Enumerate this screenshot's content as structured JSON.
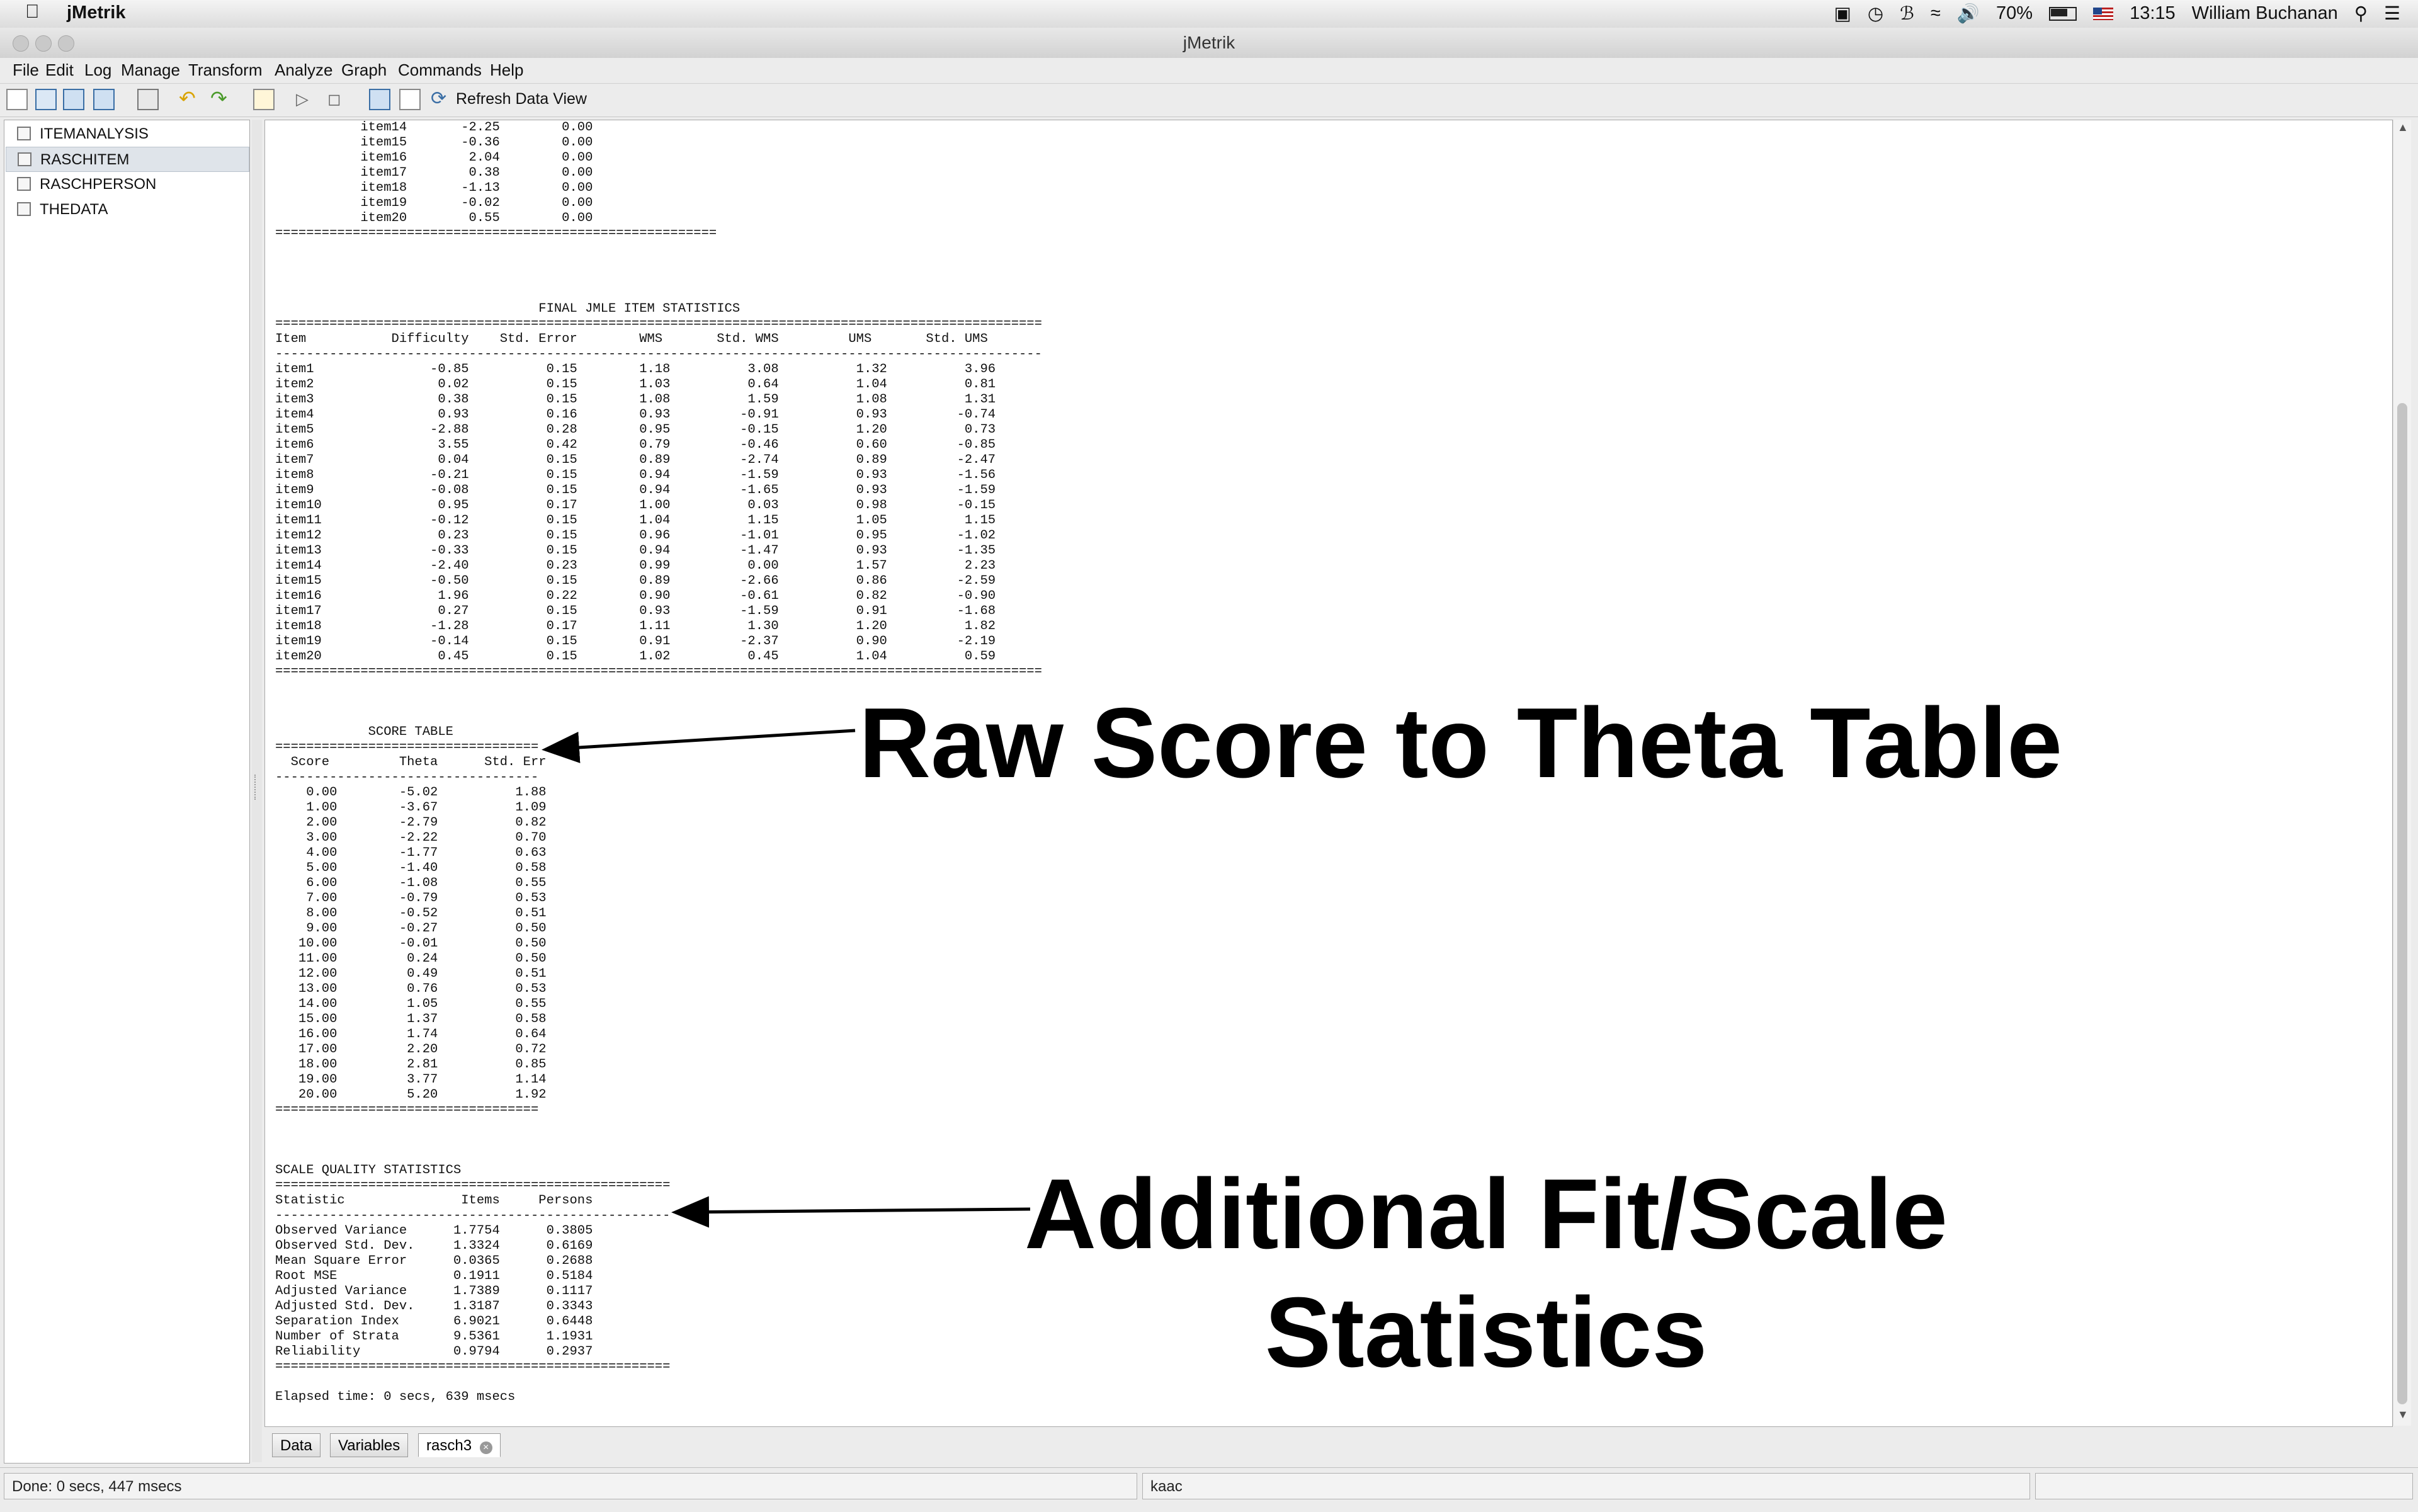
{
  "os_menubar": {
    "app_name": "jMetrik",
    "battery": "70%",
    "time": "13:15",
    "user": "William Buchanan"
  },
  "window": {
    "title": "jMetrik"
  },
  "menu": {
    "items": [
      "File",
      "Edit",
      "Log",
      "Manage",
      "Transform",
      "Analyze",
      "Graph",
      "Commands",
      "Help"
    ]
  },
  "toolbar": {
    "refresh_label": "Refresh Data View"
  },
  "sidebar": {
    "items": [
      {
        "label": "ITEMANALYSIS",
        "selected": false
      },
      {
        "label": "RASCHITEM",
        "selected": true
      },
      {
        "label": "RASCHPERSON",
        "selected": false
      },
      {
        "label": "THEDATA",
        "selected": false
      }
    ]
  },
  "output_text": "           item14       -2.25        0.00\n           item15       -0.36        0.00\n           item16        2.04        0.00\n           item17        0.38        0.00\n           item18       -1.13        0.00\n           item19       -0.02        0.00\n           item20        0.55        0.00\n=========================================================\n\n\n\n\n                                  FINAL JMLE ITEM STATISTICS\n===================================================================================================\nItem           Difficulty    Std. Error        WMS       Std. WMS         UMS       Std. UMS\n---------------------------------------------------------------------------------------------------\nitem1               -0.85          0.15        1.18          3.08          1.32          3.96\nitem2                0.02          0.15        1.03          0.64          1.04          0.81\nitem3                0.38          0.15        1.08          1.59          1.08          1.31\nitem4                0.93          0.16        0.93         -0.91          0.93         -0.74\nitem5               -2.88          0.28        0.95         -0.15          1.20          0.73\nitem6                3.55          0.42        0.79         -0.46          0.60         -0.85\nitem7                0.04          0.15        0.89         -2.74          0.89         -2.47\nitem8               -0.21          0.15        0.94         -1.59          0.93         -1.56\nitem9               -0.08          0.15        0.94         -1.65          0.93         -1.59\nitem10               0.95          0.17        1.00          0.03          0.98         -0.15\nitem11              -0.12          0.15        1.04          1.15          1.05          1.15\nitem12               0.23          0.15        0.96         -1.01          0.95         -1.02\nitem13              -0.33          0.15        0.94         -1.47          0.93         -1.35\nitem14              -2.40          0.23        0.99          0.00          1.57          2.23\nitem15              -0.50          0.15        0.89         -2.66          0.86         -2.59\nitem16               1.96          0.22        0.90         -0.61          0.82         -0.90\nitem17               0.27          0.15        0.93         -1.59          0.91         -1.68\nitem18              -1.28          0.17        1.11          1.30          1.20          1.82\nitem19              -0.14          0.15        0.91         -2.37          0.90         -2.19\nitem20               0.45          0.15        1.02          0.45          1.04          0.59\n===================================================================================================\n\n\n\n            SCORE TABLE\n==================================\n  Score         Theta      Std. Err\n----------------------------------\n    0.00        -5.02          1.88\n    1.00        -3.67          1.09\n    2.00        -2.79          0.82\n    3.00        -2.22          0.70\n    4.00        -1.77          0.63\n    5.00        -1.40          0.58\n    6.00        -1.08          0.55\n    7.00        -0.79          0.53\n    8.00        -0.52          0.51\n    9.00        -0.27          0.50\n   10.00        -0.01          0.50\n   11.00         0.24          0.50\n   12.00         0.49          0.51\n   13.00         0.76          0.53\n   14.00         1.05          0.55\n   15.00         1.37          0.58\n   16.00         1.74          0.64\n   17.00         2.20          0.72\n   18.00         2.81          0.85\n   19.00         3.77          1.14\n   20.00         5.20          1.92\n==================================\n\n\n\nSCALE QUALITY STATISTICS\n===================================================\nStatistic               Items     Persons\n---------------------------------------------------\nObserved Variance      1.7754      0.3805\nObserved Std. Dev.     1.3324      0.6169\nMean Square Error      0.0365      0.2688\nRoot MSE               0.1911      0.5184\nAdjusted Variance      1.7389      0.1117\nAdjusted Std. Dev.     1.3187      0.3343\nSeparation Index       6.9021      0.6448\nNumber of Strata       9.5361      1.1931\nReliability            0.9794      0.2937\n===================================================\n\nElapsed time: 0 secs, 639 msecs",
  "annotations": {
    "score_table_label": "Raw Score to Theta Table",
    "fit_stats_label_line1": "Additional Fit/Scale",
    "fit_stats_label_line2": "Statistics"
  },
  "tabs": [
    "Data",
    "Variables",
    "rasch3"
  ],
  "status": {
    "left": "Done: 0 secs, 447 msecs",
    "middle": "kaac"
  }
}
